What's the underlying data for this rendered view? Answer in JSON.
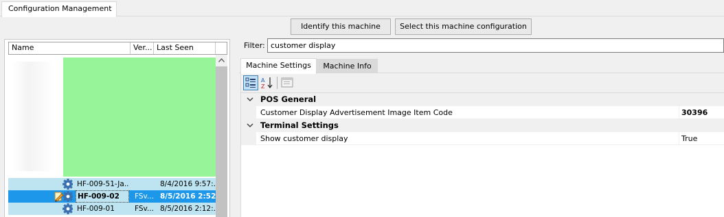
{
  "main_tab": {
    "label": "Configuration Management"
  },
  "buttons": {
    "identify": "Identify this machine",
    "select": "Select this machine configuration"
  },
  "machine_grid": {
    "columns": [
      "Name",
      "Ver...",
      "Last Seen"
    ],
    "rows": [
      {
        "name": "HF-009-51-Ja...",
        "version": "",
        "last_seen": "8/4/2016 9:57:...",
        "selected": false,
        "editing": false
      },
      {
        "name": "HF-009-02",
        "version": "FSv...",
        "last_seen": "8/5/2016 2:52:...",
        "selected": true,
        "editing": true
      },
      {
        "name": "HF-009-01",
        "version": "FSv...",
        "last_seen": "8/5/2016 2:12:...",
        "selected": false,
        "editing": false
      }
    ]
  },
  "filter": {
    "label": "Filter:",
    "value": "customer display"
  },
  "sub_tabs": {
    "active": "Machine Settings",
    "inactive": "Machine Info"
  },
  "property_grid": {
    "categories": [
      {
        "name": "POS General",
        "properties": [
          {
            "name": "Customer Display Advertisement Image Item Code",
            "value": "30396",
            "bold": true
          }
        ]
      },
      {
        "name": "Terminal Settings",
        "properties": [
          {
            "name": "Show customer display",
            "value": "True",
            "bold": false
          }
        ]
      }
    ]
  },
  "colors": {
    "background": "#f0f0f0",
    "row_highlight": "#bde4f0",
    "redaction": "#98f498",
    "accent": "#1c97ea"
  }
}
